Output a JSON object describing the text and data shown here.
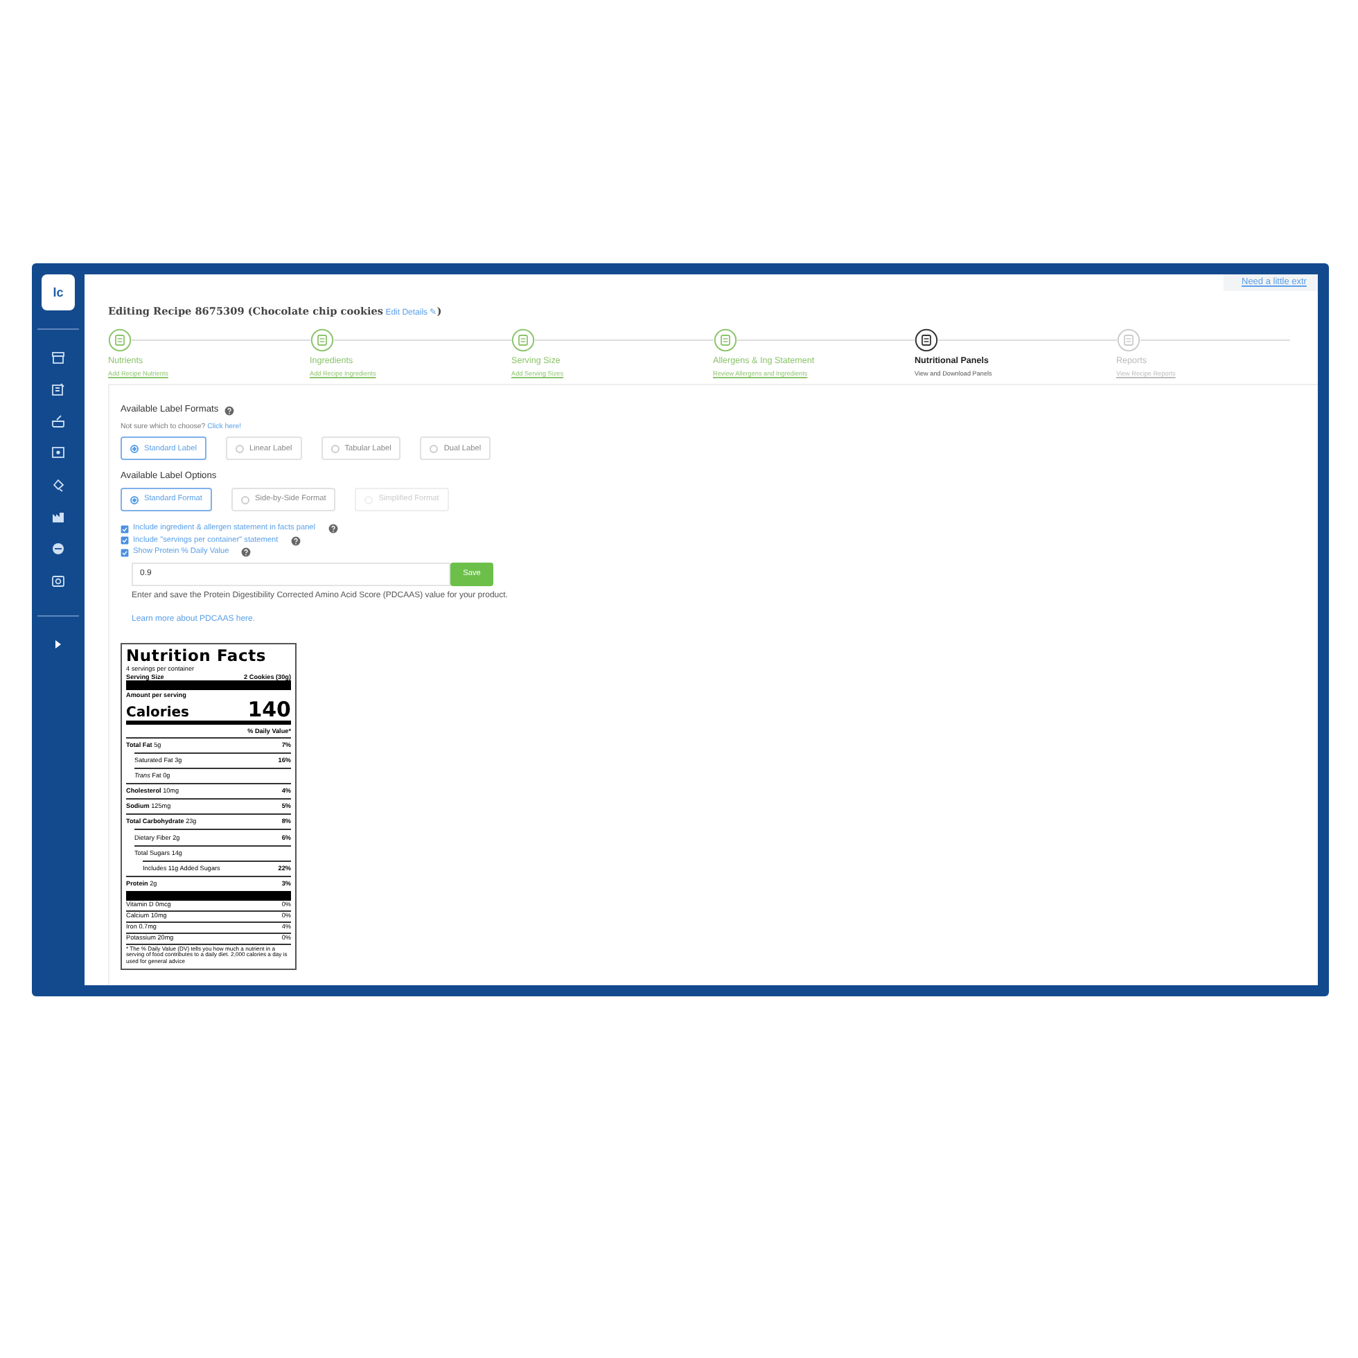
{
  "logo": {
    "text": "lc"
  },
  "help_tab": {
    "text": "Need a little extr"
  },
  "title": {
    "text": "Editing Recipe 8675309 (Chocolate chip cookies",
    "edit_link": "Edit Details ✎",
    "closing": ")"
  },
  "steps": [
    {
      "label": "Nutrients",
      "sublink": "Add Recipe Nutrients",
      "done": true,
      "selected": false
    },
    {
      "label": "Ingredients",
      "sublink": "Add Recipe Ingredients",
      "done": true,
      "selected": false
    },
    {
      "label": "Serving Size",
      "sublink": "Add Serving Sizes",
      "done": true,
      "selected": false
    },
    {
      "label": "Allergens & Ing Statement",
      "sublink": "Review Allergens and Ingredients",
      "done": true,
      "selected": false
    },
    {
      "label": "Nutritional Panels",
      "sublink": "View and Download Panels",
      "done": false,
      "selected": true
    },
    {
      "label": "Reports",
      "sublink": "View Recipe Reports",
      "done": false,
      "selected": false
    }
  ],
  "formats": {
    "heading": "Available Label Formats",
    "hint": "Not sure which to choose?",
    "hint_link": "Click here!",
    "options": [
      {
        "label": "Standard Label",
        "selected": true,
        "disabled": false
      },
      {
        "label": "Linear Label",
        "selected": false,
        "disabled": false
      },
      {
        "label": "Tabular Label",
        "selected": false,
        "disabled": false
      },
      {
        "label": "Dual Label",
        "selected": false,
        "disabled": false
      }
    ]
  },
  "label_options": {
    "heading": "Available Label Options",
    "options": [
      {
        "label": "Standard Format",
        "selected": true,
        "disabled": false
      },
      {
        "label": "Side-by-Side Format",
        "selected": false,
        "disabled": false
      },
      {
        "label": "Simplified Format",
        "selected": false,
        "disabled": true
      }
    ]
  },
  "checkboxes": [
    {
      "label": "Include ingredient & allergen statement in facts panel",
      "checked": true
    },
    {
      "label": "Include \"servings per container\" statement",
      "checked": true
    },
    {
      "label": "Show Protein % Daily Value",
      "checked": true
    }
  ],
  "pdcaas": {
    "value": "0.9",
    "button": "Save",
    "note": "Enter and save the Protein Digestibility Corrected Amino Acid Score (PDCAAS) value for your product.",
    "link": "Learn more about PDCAAS here."
  },
  "nutrition_label": {
    "title": "Nutrition Facts",
    "servings": "4 servings per container",
    "serving_size_label": "Serving Size",
    "serving_size_value": "2 Cookies (30g)",
    "amount_label": "Amount per serving",
    "calories_label": "Calories",
    "calories_value": "140",
    "dv_header": "% Daily Value*",
    "nutrients": [
      {
        "name": "Total Fat",
        "amount": "5g",
        "dv": "7%",
        "children": [
          {
            "name": "Saturated Fat",
            "amount": "3g",
            "dv": "16%"
          },
          {
            "name": "*Trans* Fat",
            "amount": "0g"
          }
        ]
      },
      {
        "name": "Cholesterol",
        "amount": "10mg",
        "dv": "4%"
      },
      {
        "name": "Sodium",
        "amount": "125mg",
        "dv": "5%"
      },
      {
        "name": "Total Carbohydrate",
        "amount": "23g",
        "dv": "8%",
        "children": [
          {
            "name": "Dietary Fiber",
            "amount": "2g",
            "dv": "6%"
          },
          {
            "name": "Total Sugars",
            "amount": "14g",
            "children": [
              {
                "name": "Includes 11g Added Sugars",
                "dv": "22%"
              }
            ]
          }
        ]
      },
      {
        "name": "Protein",
        "amount": "2g",
        "dv": "3%"
      }
    ],
    "vitamins": [
      {
        "name": "Vitamin D",
        "amount": "0mcg",
        "dv": "0%"
      },
      {
        "name": "Calcium",
        "amount": "10mg",
        "dv": "0%"
      },
      {
        "name": "Iron",
        "amount": "0.7mg",
        "dv": "4%"
      },
      {
        "name": "Potassium",
        "amount": "20mg",
        "dv": "0%"
      }
    ],
    "footnote": "* The % Daily Value (DV) tells you how much a nutrient in a serving of food contributes to a daily diet. 2,000 calories a day is used for general advice"
  }
}
